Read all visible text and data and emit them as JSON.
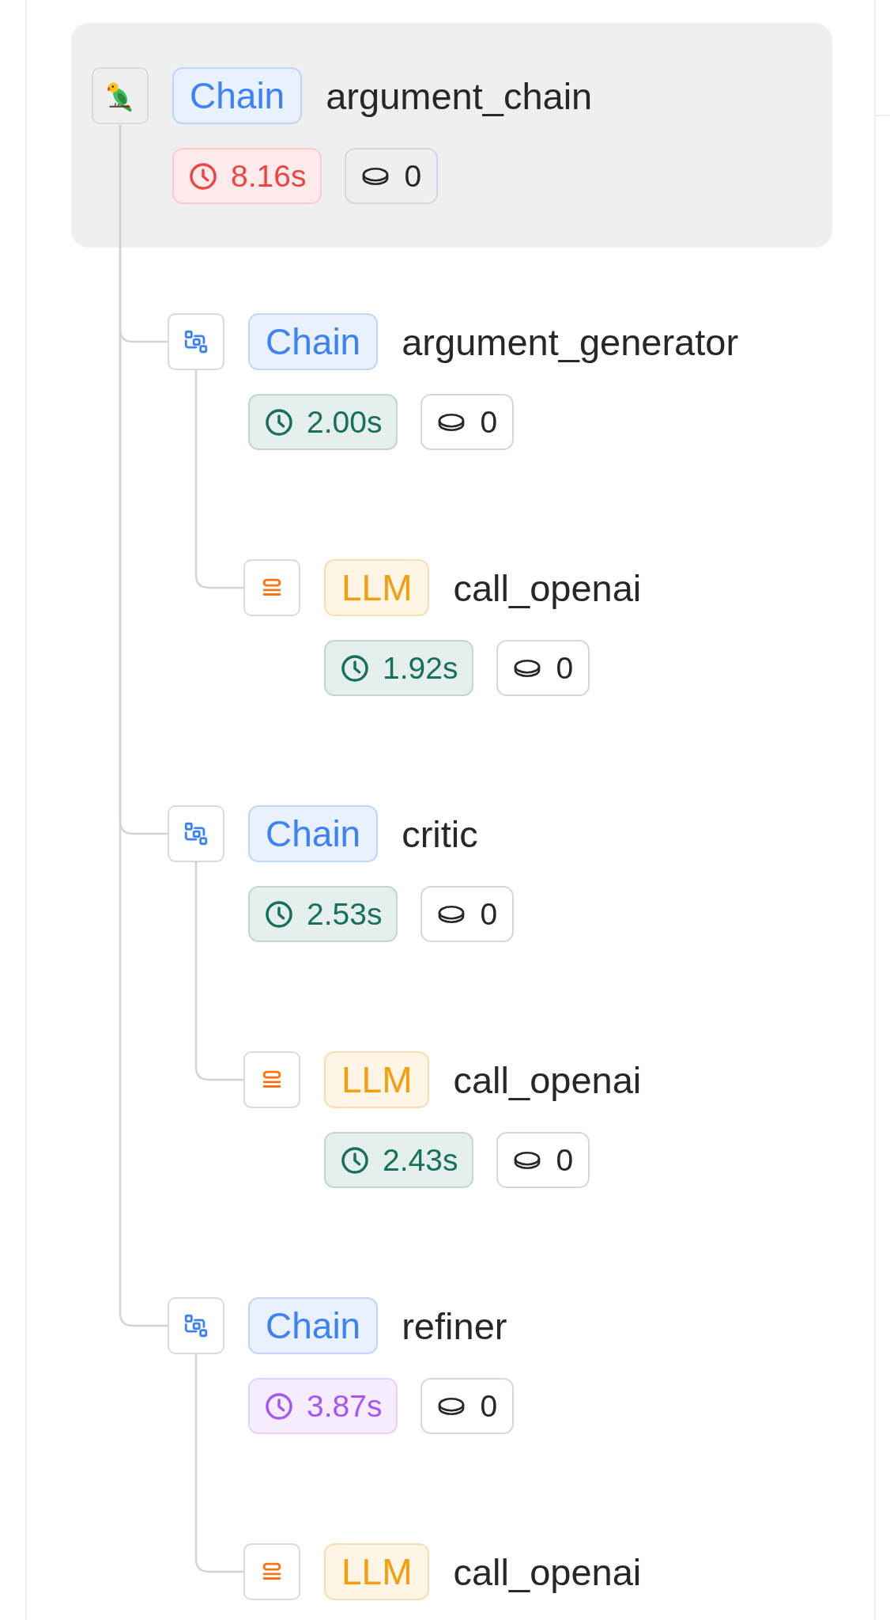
{
  "trace": {
    "nodes": [
      {
        "kind": "chain",
        "label": "Chain",
        "name": "argument_chain",
        "selected": true,
        "duration": {
          "text": "8.16s",
          "color": "#ef4444"
        },
        "tokens": "0",
        "children": [
          {
            "kind": "chain",
            "label": "Chain",
            "name": "argument_generator",
            "selected": false,
            "duration": {
              "text": "2.00s",
              "color": "#16705c"
            },
            "tokens": "0",
            "children": [
              {
                "kind": "llm",
                "label": "LLM",
                "name": "call_openai",
                "selected": false,
                "duration": {
                  "text": "1.92s",
                  "color": "#16705c"
                },
                "tokens": "0"
              }
            ]
          },
          {
            "kind": "chain",
            "label": "Chain",
            "name": "critic",
            "selected": false,
            "duration": {
              "text": "2.53s",
              "color": "#16705c"
            },
            "tokens": "0",
            "children": [
              {
                "kind": "llm",
                "label": "LLM",
                "name": "call_openai",
                "selected": false,
                "duration": {
                  "text": "2.43s",
                  "color": "#16705c"
                },
                "tokens": "0"
              }
            ]
          },
          {
            "kind": "chain",
            "label": "Chain",
            "name": "refiner",
            "selected": false,
            "duration": {
              "text": "3.87s",
              "color": "#a855f7"
            },
            "tokens": "0",
            "children": [
              {
                "kind": "llm",
                "label": "LLM",
                "name": "call_openai",
                "selected": false
              }
            ]
          }
        ]
      }
    ]
  }
}
